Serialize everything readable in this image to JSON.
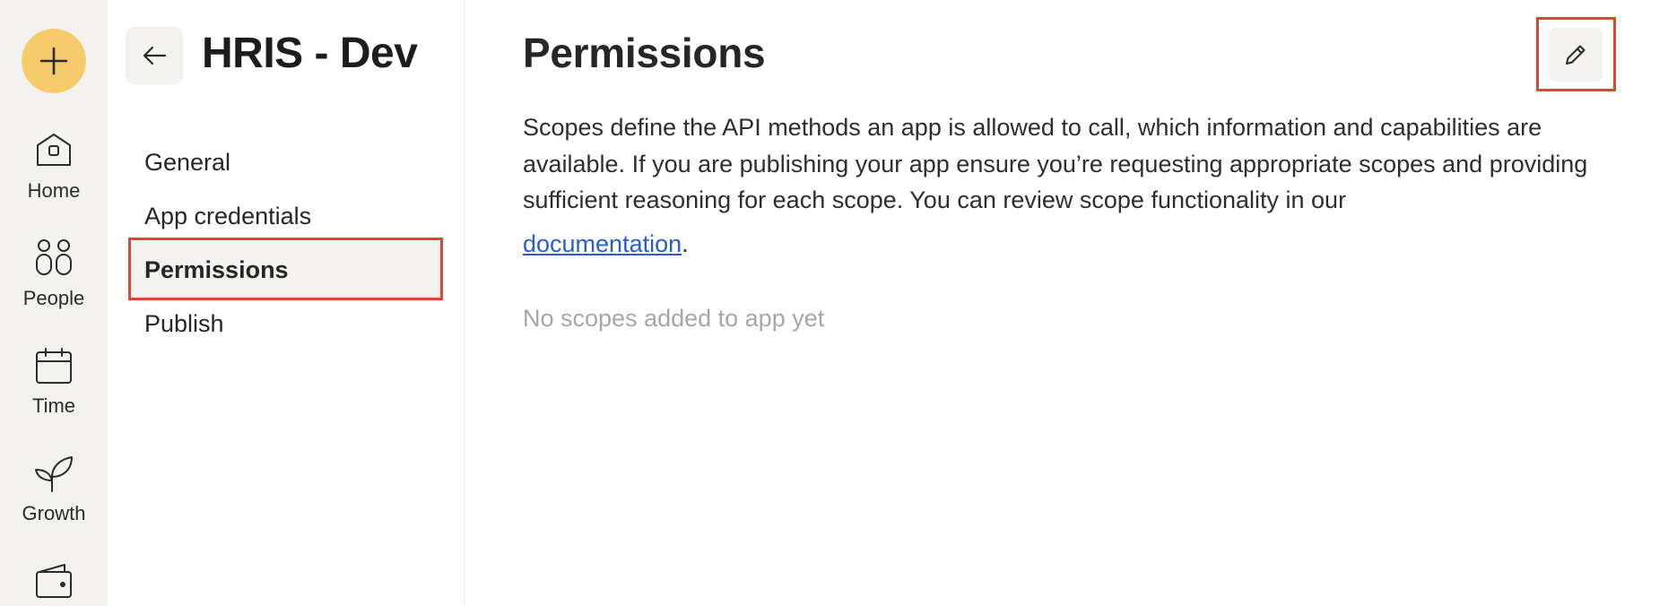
{
  "rail": {
    "items": [
      {
        "label": "Home",
        "icon": "home-icon"
      },
      {
        "label": "People",
        "icon": "people-icon"
      },
      {
        "label": "Time",
        "icon": "calendar-icon"
      },
      {
        "label": "Growth",
        "icon": "sprout-icon"
      },
      {
        "label": "",
        "icon": "wallet-icon"
      }
    ]
  },
  "subnav": {
    "title": "HRIS - Dev",
    "items": [
      {
        "label": "General"
      },
      {
        "label": "App credentials"
      },
      {
        "label": "Permissions",
        "active": true
      },
      {
        "label": "Publish"
      }
    ]
  },
  "main": {
    "title": "Permissions",
    "description": "Scopes define the API methods an app is allowed to call, which information and capabilities are available. If you are publishing your app ensure you’re requesting appropriate scopes and providing sufficient reasoning for each scope. You can review scope functionality in our",
    "doc_link": "documentation",
    "doc_suffix": ".",
    "empty_state": "No scopes added to app yet"
  },
  "colors": {
    "accent_yellow": "#f7cb6b",
    "rail_bg": "#f3f2ef",
    "link": "#2a5bd7",
    "highlight": "#e0462f"
  }
}
